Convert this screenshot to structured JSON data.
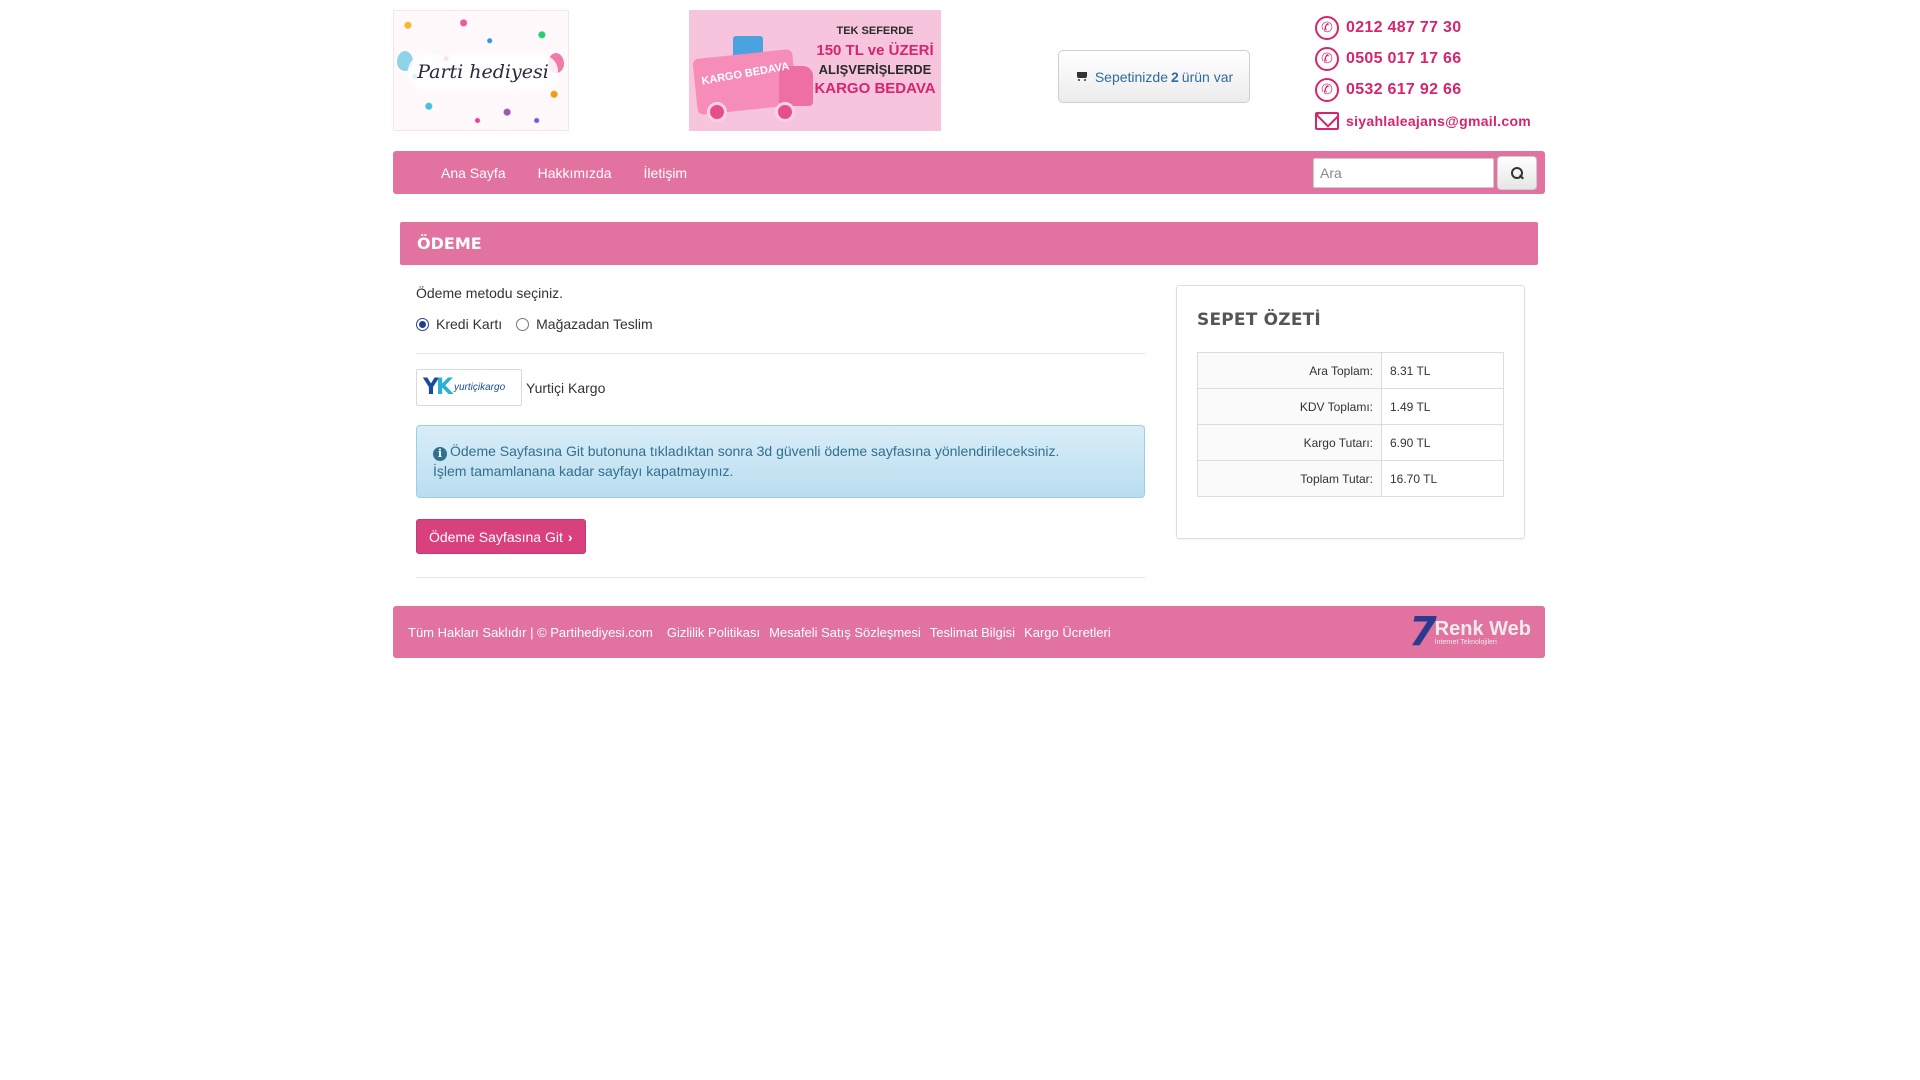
{
  "header": {
    "logo_text": "Parti hediyesi",
    "promo": {
      "line1": "TEK SEFERDE",
      "line2": "150 TL ve ÜZERİ",
      "line3": "ALIŞVERİŞLERDE",
      "line4": "KARGO BEDAVA",
      "truck_text": "KARGO BEDAVA"
    },
    "cart": {
      "prefix": "Sepetinizde",
      "count": "2",
      "suffix": "ürün var"
    },
    "contacts": {
      "phone1": "0212 487 77 30",
      "phone2": "0505 017 17 66",
      "phone3": "0532 617 92 66",
      "email": "siyahlaleajans@gmail.com"
    }
  },
  "nav": {
    "items": [
      "Ana Sayfa",
      "Hakkımızda",
      "İletişim"
    ],
    "search_placeholder": "Ara"
  },
  "page": {
    "title": "ÖDEME"
  },
  "payment": {
    "prompt": "Ödeme metodu seçiniz.",
    "options": [
      {
        "label": "Kredi Kartı",
        "selected": true
      },
      {
        "label": "Mağazadan Teslim",
        "selected": false
      }
    ],
    "shipping_logo_text": "yurtiçikargo",
    "shipping_name": "Yurtiçi Kargo",
    "info_line1": "Ödeme Sayfasına Git butonuna tıkladıktan sonra 3d güvenli ödeme sayfasına yönlendirileceksiniz.",
    "info_line2": "İşlem tamamlanana kadar sayfayı kapatmayınız.",
    "submit_label": "Ödeme Sayfasına Git"
  },
  "summary": {
    "title": "SEPET ÖZETİ",
    "rows": [
      {
        "label": "Ara Toplam:",
        "value": "8.31 TL"
      },
      {
        "label": "KDV Toplamı:",
        "value": "1.49 TL"
      },
      {
        "label": "Kargo Tutarı:",
        "value": "6.90 TL"
      },
      {
        "label": "Toplam Tutar:",
        "value": "16.70 TL"
      }
    ]
  },
  "footer": {
    "copyright": "Tüm Hakları Saklıdır | © Partihediyesi.com",
    "links": [
      "Gizlilik Politikası",
      "Mesafeli Satış Sözleşmesi",
      "Teslimat Bilgisi",
      "Kargo Ücretleri"
    ],
    "brand_mark": "7",
    "brand_name": "Renk Web",
    "brand_tagline": "İnternet Teknolojileri"
  },
  "colors": {
    "brand_pink": "#e2729f",
    "button_pink": "#d9407e",
    "contact_pink": "#d6246e",
    "info_blue": "#31708f"
  },
  "icons": [
    "cart-icon",
    "phone-icon",
    "mail-icon",
    "search-icon",
    "info-icon",
    "chevron-right-icon"
  ]
}
